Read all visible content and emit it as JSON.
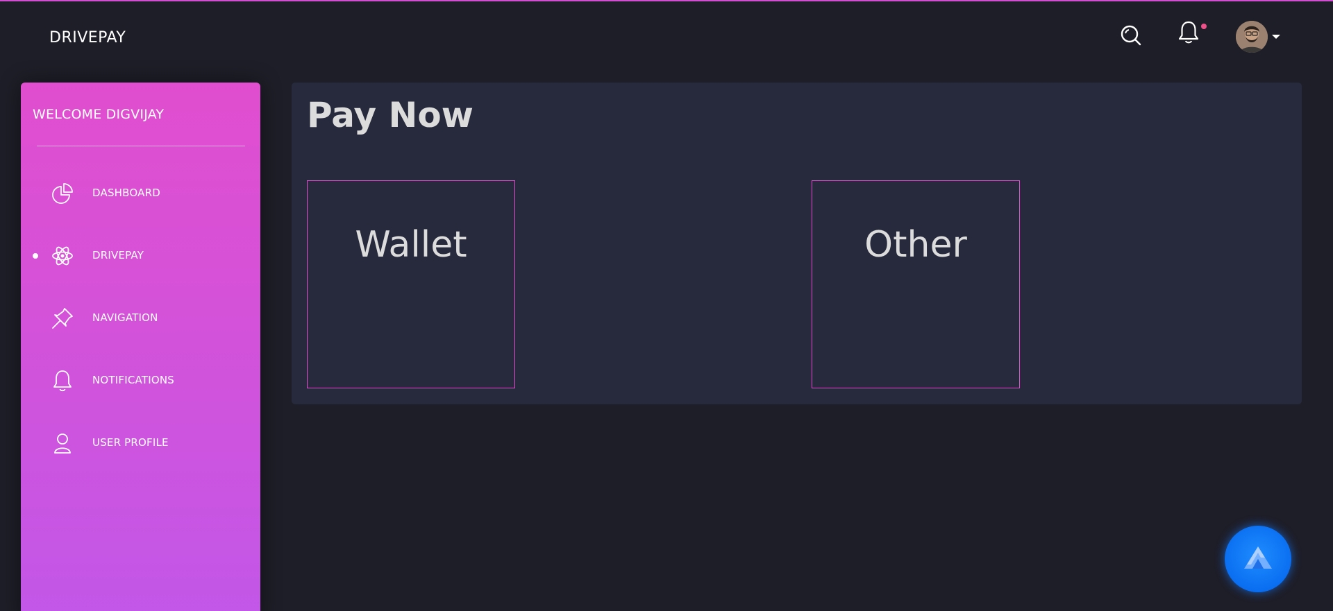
{
  "app": {
    "brand": "DRIVEPAY",
    "accent_color": "#e14ecf",
    "background_color": "#1e1e28",
    "card_color": "#272a3d"
  },
  "navbar": {
    "icons": [
      "search-icon",
      "bell-icon",
      "avatar",
      "caret-down-icon"
    ],
    "notification_dot_color": "#f0508a"
  },
  "sidebar": {
    "welcome": "WELCOME DIGVIJAY",
    "items": [
      {
        "label": "DASHBOARD",
        "icon": "pie-chart-icon",
        "active": false
      },
      {
        "label": "DRIVEPAY",
        "icon": "atom-icon",
        "active": true
      },
      {
        "label": "NAVIGATION",
        "icon": "pin-icon",
        "active": false
      },
      {
        "label": "NOTIFICATIONS",
        "icon": "bell-icon",
        "active": false
      },
      {
        "label": "USER PROFILE",
        "icon": "user-icon",
        "active": false
      }
    ]
  },
  "main": {
    "title": "Pay Now",
    "options": [
      {
        "label": "Wallet"
      },
      {
        "label": "Other"
      }
    ]
  },
  "fab": {
    "icon": "assistant-logo-icon",
    "color": "#1e8cff"
  }
}
